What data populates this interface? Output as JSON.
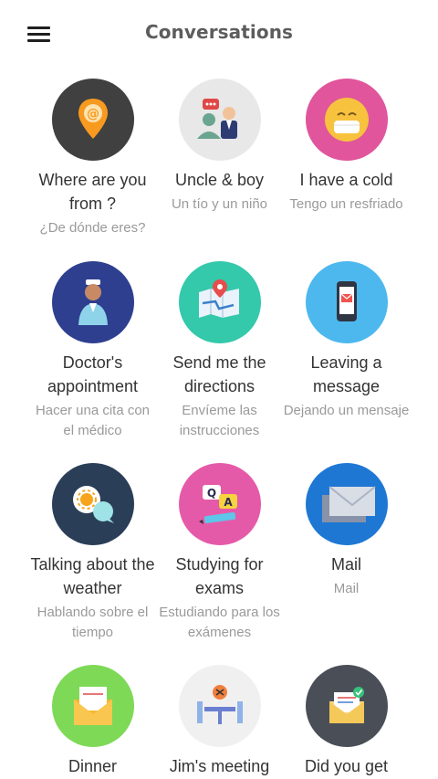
{
  "header": {
    "title": "Conversations"
  },
  "conversations": [
    {
      "title": "Where are you from ?",
      "subtitle": "¿De dónde eres?",
      "icon": "location-pin-icon",
      "color": "#404040"
    },
    {
      "title": "Uncle & boy",
      "subtitle": "Un tío y un niño",
      "icon": "people-chat-icon",
      "color": "#e8e8e8"
    },
    {
      "title": "I have a cold",
      "subtitle": "Tengo un resfriado",
      "icon": "sick-face-icon",
      "color": "#e0559b"
    },
    {
      "title": "Doctor's appointment",
      "subtitle": "Hacer una cita con el médico",
      "icon": "doctor-icon",
      "color": "#2e3f8f"
    },
    {
      "title": "Send me the directions",
      "subtitle": "Envíeme las instrucciones",
      "icon": "map-icon",
      "color": "#33c9aa"
    },
    {
      "title": "Leaving a message",
      "subtitle": "Dejando un mensaje",
      "icon": "phone-message-icon",
      "color": "#4db8ee"
    },
    {
      "title": "Talking about the weather",
      "subtitle": "Hablando sobre el tiempo",
      "icon": "weather-chat-icon",
      "color": "#2b3e57"
    },
    {
      "title": "Studying for exams",
      "subtitle": "Estudiando para los exámenes",
      "icon": "qa-exam-icon",
      "color": "#e55aa8"
    },
    {
      "title": "Mail",
      "subtitle": "Mail",
      "icon": "envelope-icon",
      "color": "#1f77d4"
    },
    {
      "title": "Dinner",
      "subtitle": "",
      "icon": "dinner-invitation-icon",
      "color": "#7ed957"
    },
    {
      "title": "Jim's meeting",
      "subtitle": "",
      "icon": "meeting-table-icon",
      "color": "#f0f0f0"
    },
    {
      "title": "Did you get",
      "subtitle": "",
      "icon": "envelope-check-icon",
      "color": "#4a4f57"
    }
  ]
}
